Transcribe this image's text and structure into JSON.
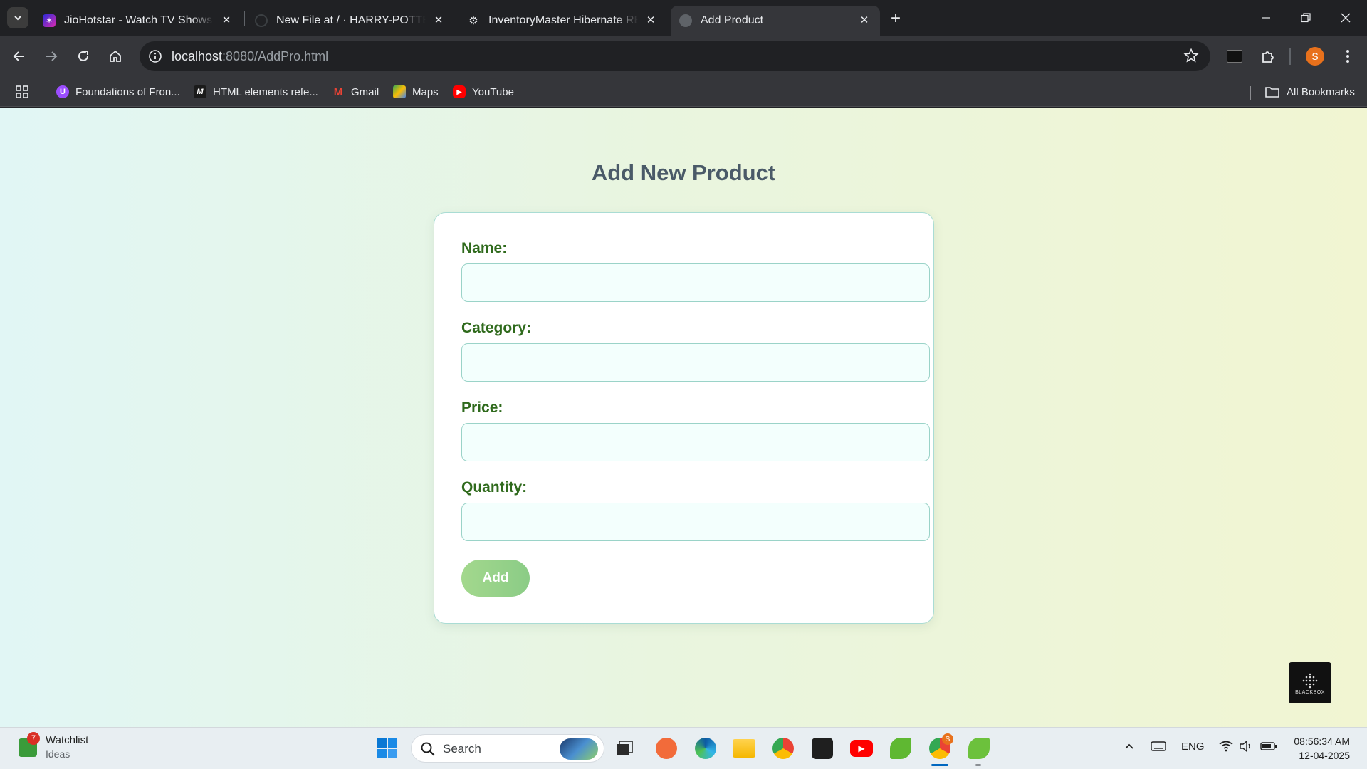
{
  "tabs": [
    {
      "title": "JioHotstar - Watch TV Shows, M",
      "favicon_color": "#5b2bd9"
    },
    {
      "title": "New File at / · HARRY-POTTER-V",
      "favicon_color": "#202124"
    },
    {
      "title": "InventoryMaster Hibernate REA",
      "favicon_color": "#202124"
    },
    {
      "title": "Add Product",
      "favicon_color": "#5f6368",
      "active": true
    }
  ],
  "address_bar": {
    "host": "localhost",
    "path": ":8080/AddPro.html"
  },
  "bookmarks": [
    {
      "label": "Foundations of Fron...",
      "icon": "u-icon",
      "color": "#9b4dff"
    },
    {
      "label": "HTML elements refe...",
      "icon": "mdn-icon",
      "color": "#1b1b1b"
    },
    {
      "label": "Gmail",
      "icon": "gmail-icon",
      "color": "#ea4335"
    },
    {
      "label": "Maps",
      "icon": "maps-icon",
      "color": "#34a853"
    },
    {
      "label": "YouTube",
      "icon": "youtube-icon",
      "color": "#ff0000"
    }
  ],
  "all_bookmarks_label": "All Bookmarks",
  "profile_initial": "S",
  "page": {
    "title": "Add New Product",
    "fields": [
      {
        "label": "Name:",
        "value": ""
      },
      {
        "label": "Category:",
        "value": ""
      },
      {
        "label": "Price:",
        "value": ""
      },
      {
        "label": "Quantity:",
        "value": ""
      }
    ],
    "submit_label": "Add",
    "blackbox_label": "BLACKBOX"
  },
  "taskbar": {
    "widget_title": "Watchlist",
    "widget_subtitle": "Ideas",
    "widget_badge": "7",
    "search_placeholder": "Search",
    "language": "ENG",
    "time": "08:56:34 AM",
    "date": "12-04-2025",
    "chrome_badge": "S"
  },
  "colors": {
    "accent_green": "#2f6a1c",
    "button_green": "#9ad48a",
    "title_gray": "#4a5a68"
  }
}
